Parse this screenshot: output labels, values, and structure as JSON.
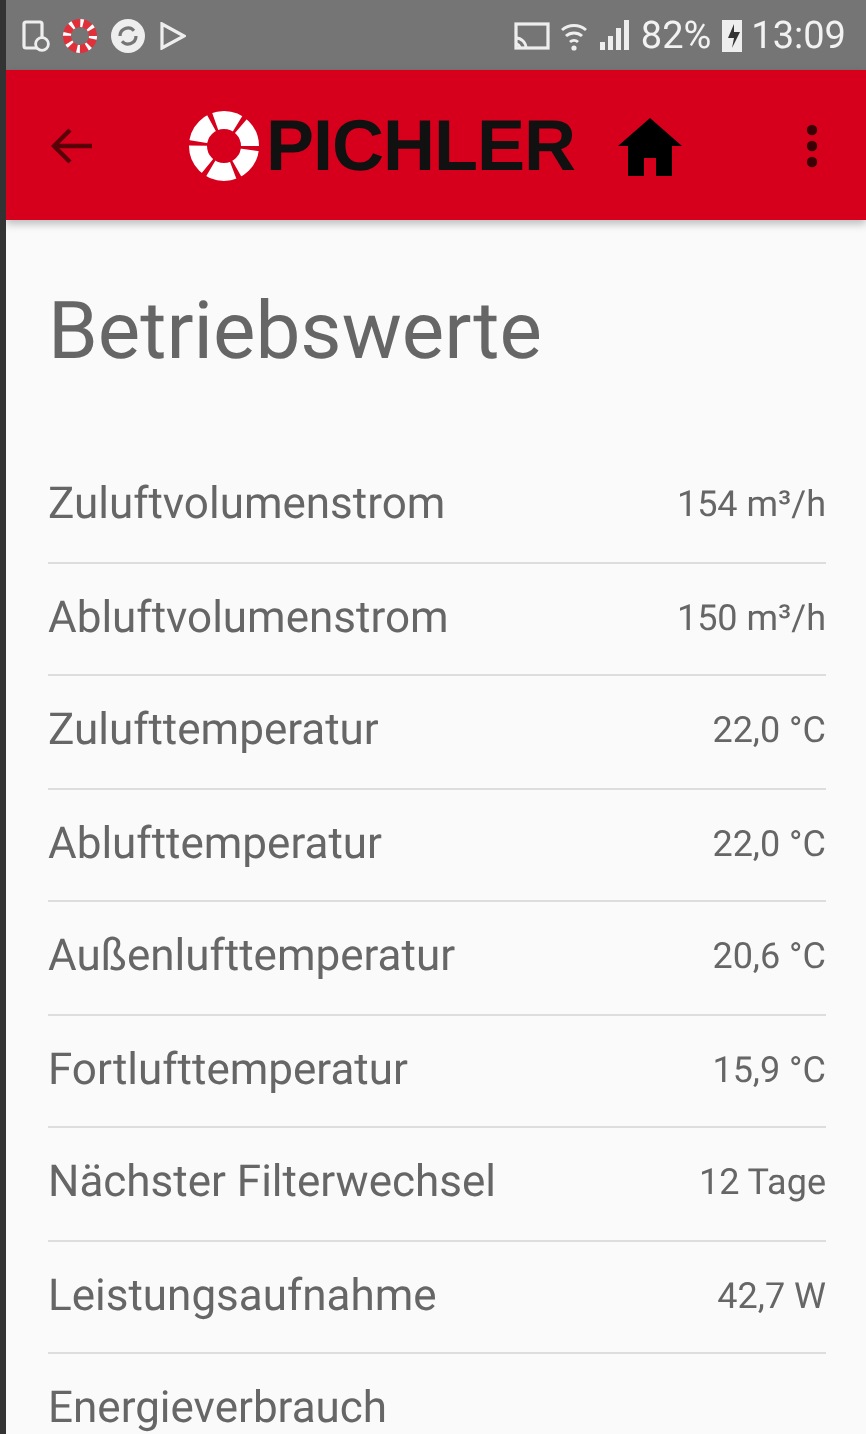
{
  "status_bar": {
    "battery": "82%",
    "time": "13:09"
  },
  "app_bar": {
    "logo": "PICHLER"
  },
  "title": "Betriebswerte",
  "rows": [
    {
      "label": "Zuluftvolumenstrom",
      "value": "154 m³/h"
    },
    {
      "label": "Abluftvolumenstrom",
      "value": "150 m³/h"
    },
    {
      "label": "Zulufttemperatur",
      "value": "22,0 °C"
    },
    {
      "label": "Ablufttemperatur",
      "value": "22,0 °C"
    },
    {
      "label": "Außenlufttemperatur",
      "value": "20,6 °C"
    },
    {
      "label": "Fortlufttemperatur",
      "value": "15,9 °C"
    },
    {
      "label": "Nächster Filterwechsel",
      "value": "12 Tage"
    },
    {
      "label": "Leistungsaufnahme",
      "value": "42,7 W"
    },
    {
      "label": "Energieverbrauch"
    }
  ]
}
